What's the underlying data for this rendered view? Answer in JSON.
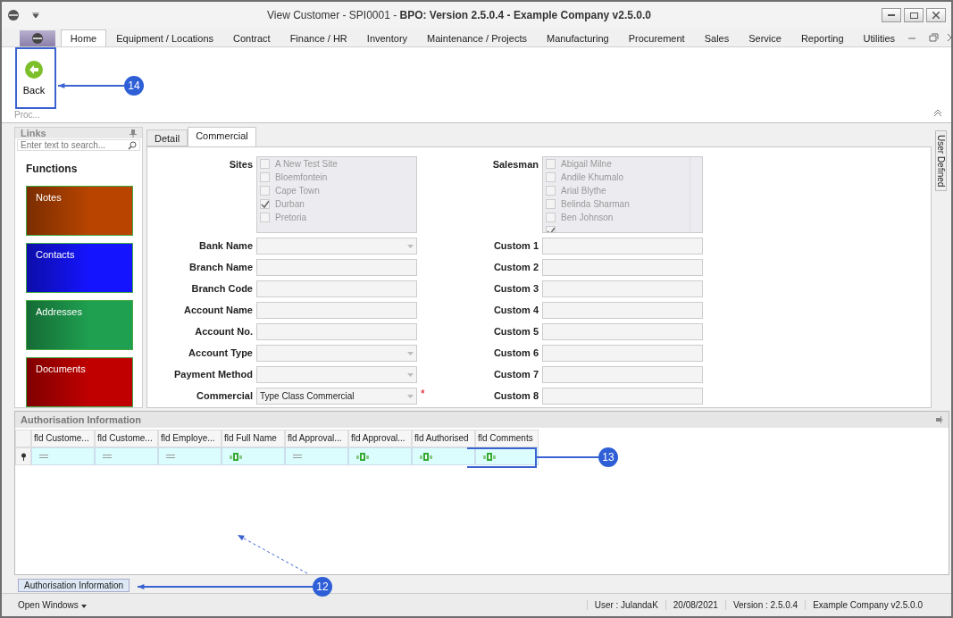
{
  "window": {
    "title": "View Customer - SPI0001 - **BPO: Version 2.5.0.4 - Example Company v2.5.0.0**"
  },
  "ribbon": {
    "tabs": [
      {
        "label": "Home",
        "selected": true
      },
      {
        "label": "Equipment / Locations",
        "selected": false
      },
      {
        "label": "Contract",
        "selected": false
      },
      {
        "label": "Finance / HR",
        "selected": false
      },
      {
        "label": "Inventory",
        "selected": false
      },
      {
        "label": "Maintenance / Projects",
        "selected": false
      },
      {
        "label": "Manufacturing",
        "selected": false
      },
      {
        "label": "Procurement",
        "selected": false
      },
      {
        "label": "Sales",
        "selected": false
      },
      {
        "label": "Service",
        "selected": false
      },
      {
        "label": "Reporting",
        "selected": false
      },
      {
        "label": "Utilities",
        "selected": false
      }
    ],
    "buttons": [
      {
        "label": "Back"
      }
    ],
    "group_label": "Proc..."
  },
  "links": {
    "title": "Links",
    "search": {
      "placeholder": "Enter text to search..."
    },
    "heading": "Functions",
    "tiles": [
      {
        "label": "Notes",
        "color": "#b84400"
      },
      {
        "label": "Contacts",
        "color": "#1414ff"
      },
      {
        "label": "Addresses",
        "color": "#1fa050"
      },
      {
        "label": "Documents",
        "color": "#c00000"
      }
    ]
  },
  "form_tabs": [
    {
      "label": "Detail",
      "selected": false
    },
    {
      "label": "Commercial",
      "selected": true
    }
  ],
  "side_tab": "User Defined",
  "sites": {
    "label": "Sites",
    "items": [
      {
        "label": "A New Test Site",
        "checked": false
      },
      {
        "label": "Bloemfontein",
        "checked": false
      },
      {
        "label": "Cape Town",
        "checked": false
      },
      {
        "label": "Durban",
        "checked": true
      },
      {
        "label": "Pretoria",
        "checked": false
      }
    ]
  },
  "salesman": {
    "label": "Salesman",
    "items": [
      {
        "label": "Abigail Milne",
        "checked": false
      },
      {
        "label": "Andile Khumalo",
        "checked": false
      },
      {
        "label": "Arial Blythe",
        "checked": false
      },
      {
        "label": "Belinda Sharman",
        "checked": false
      },
      {
        "label": "Ben Johnson",
        "checked": false
      },
      {
        "checked": true
      }
    ]
  },
  "left_fields": [
    {
      "label": "Bank Name",
      "kind": "combo"
    },
    {
      "label": "Branch Name",
      "kind": "text"
    },
    {
      "label": "Branch Code",
      "kind": "text"
    },
    {
      "label": "Account Name",
      "kind": "text"
    },
    {
      "label": "Account No.",
      "kind": "text"
    },
    {
      "label": "Account Type",
      "kind": "combo"
    },
    {
      "label": "Payment Method",
      "kind": "combo"
    },
    {
      "label": "Commercial",
      "kind": "combo",
      "value": "Type Class Commercial",
      "required_mark": "*"
    }
  ],
  "right_fields": [
    {
      "label": "Custom 1"
    },
    {
      "label": "Custom 2"
    },
    {
      "label": "Custom 3"
    },
    {
      "label": "Custom 4"
    },
    {
      "label": "Custom 5"
    },
    {
      "label": "Custom 6"
    },
    {
      "label": "Custom 7"
    },
    {
      "label": "Custom 8"
    }
  ],
  "auth_panel": {
    "title": "Authorisation Information",
    "columns": [
      {
        "label": "fld Custome...",
        "kind": "number"
      },
      {
        "label": "fld Custome...",
        "kind": "number"
      },
      {
        "label": "fld Employe...",
        "kind": "number"
      },
      {
        "label": "fld Full Name",
        "kind": "text"
      },
      {
        "label": "fld Approval...",
        "kind": "number"
      },
      {
        "label": "fld Approval...",
        "kind": "text"
      },
      {
        "label": "fld Authorised",
        "kind": "text"
      },
      {
        "label": "fld Comments",
        "kind": "text"
      }
    ]
  },
  "bottom_tab": "Authorisation Information",
  "status_bar": {
    "open_windows": "Open Windows",
    "items": [
      "User : JulandaK",
      "20/08/2021",
      "Version : 2.5.0.4",
      "Example Company v2.5.0.0"
    ]
  },
  "annotations": [
    {
      "number": "14"
    },
    {
      "number": "13"
    },
    {
      "number": "12"
    }
  ]
}
